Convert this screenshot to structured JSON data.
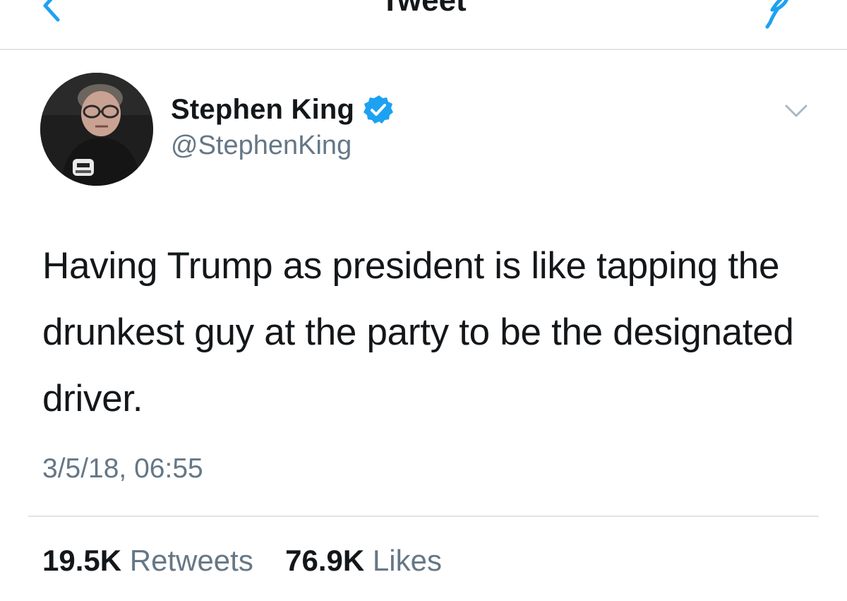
{
  "navbar": {
    "title": "Tweet",
    "back_icon": "chevron-left-icon",
    "compose_icon": "compose-feather-icon",
    "accent_color": "#1da1f2"
  },
  "author": {
    "display_name": "Stephen King",
    "handle": "@StephenKing",
    "verified": true,
    "verified_icon": "verified-badge-icon",
    "avatar_icon": "profile-photo"
  },
  "tweet": {
    "text": "Having Trump as president is like tapping the drunkest guy at the party to be the designated driver.",
    "timestamp": "3/5/18, 06:55",
    "menu_icon": "chevron-down-icon"
  },
  "stats": {
    "retweets_count": "19.5K",
    "retweets_label": "Retweets",
    "likes_count": "76.9K",
    "likes_label": "Likes"
  },
  "colors": {
    "text_primary": "#14171a",
    "text_secondary": "#657786",
    "divider": "#e1e4e8",
    "verified_blue": "#1da1f2"
  }
}
